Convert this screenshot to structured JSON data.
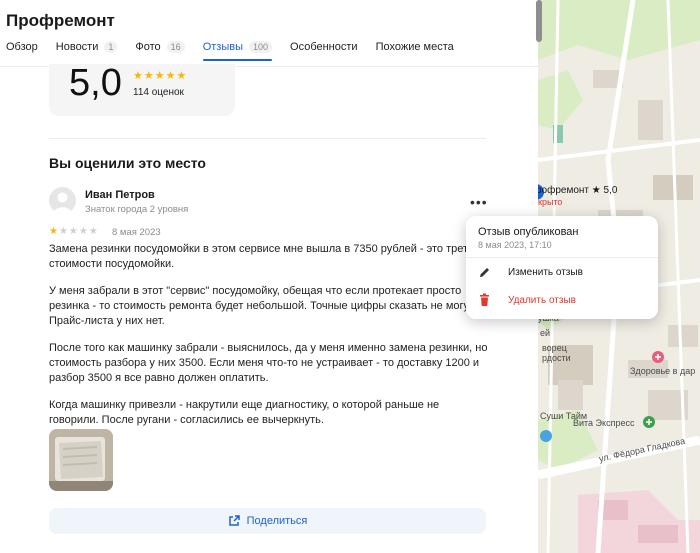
{
  "org": {
    "title": "Профремонт"
  },
  "tabs": [
    {
      "label": "Обзор",
      "count": null
    },
    {
      "label": "Новости",
      "count": "1"
    },
    {
      "label": "Фото",
      "count": "16"
    },
    {
      "label": "Отзывы",
      "count": "100"
    },
    {
      "label": "Особенности",
      "count": null
    },
    {
      "label": "Похожие места",
      "count": null
    }
  ],
  "rating": {
    "value": "5,0",
    "stars": "★★★★★",
    "count_label": "114 оценок"
  },
  "my_review": {
    "section_title": "Вы оценили это место",
    "author_name": "Иван Петров",
    "author_level": "Знаток города 2 уровня",
    "rating": 1,
    "stars_on": "★",
    "stars_off": "★★★★",
    "date": "8 мая 2023",
    "paragraphs": [
      "Замена резинки посудомойки в этом сервисе мне вышла в 7350 рублей - это трет\nстоимости посудомойки.",
      "У меня забрали в этот \"сервис\" посудомойку, обещая что если протекает просто\nрезинка - то стоимость ремонта будет небольшой. Точные цифры сказать не могу\nПрайс-листа у них нет.",
      "После того как машинку забрали - выяснилось, да у меня именно замена резинки, но\nстоимость разбора у них 3500. Если меня что-то не устраивает - то доставку 1200 и\nразбор 3500 я все равно должен оплатить.",
      "Когда машинку привезли - накрутили еще диагностику, о которой раньше не\nговорили. После ругани - согласились ее вычеркнуть."
    ],
    "share_label": "Поделиться"
  },
  "popup": {
    "title": "Отзыв опубликован",
    "date": "8 мая 2023, 17:10",
    "edit_label": "Изменить отзыв",
    "delete_label": "Удалить отзыв"
  },
  "map": {
    "place_label": "рофремонт ★ 5,0",
    "place_status": "крыто",
    "poi_1": "Здоровье в дар",
    "poi_2": "Вита Экспресс",
    "poi_3": "Суши Тайм",
    "street": "ул. Фёдора Гладкова",
    "frag_1": "рдости",
    "frag_2": "ворец",
    "frag_3": "ей",
    "frag_4": "ушка"
  },
  "colors": {
    "accent": "#1e62d0",
    "star": "#f8b706",
    "danger": "#e0392d",
    "map_bg": "#efece4"
  }
}
